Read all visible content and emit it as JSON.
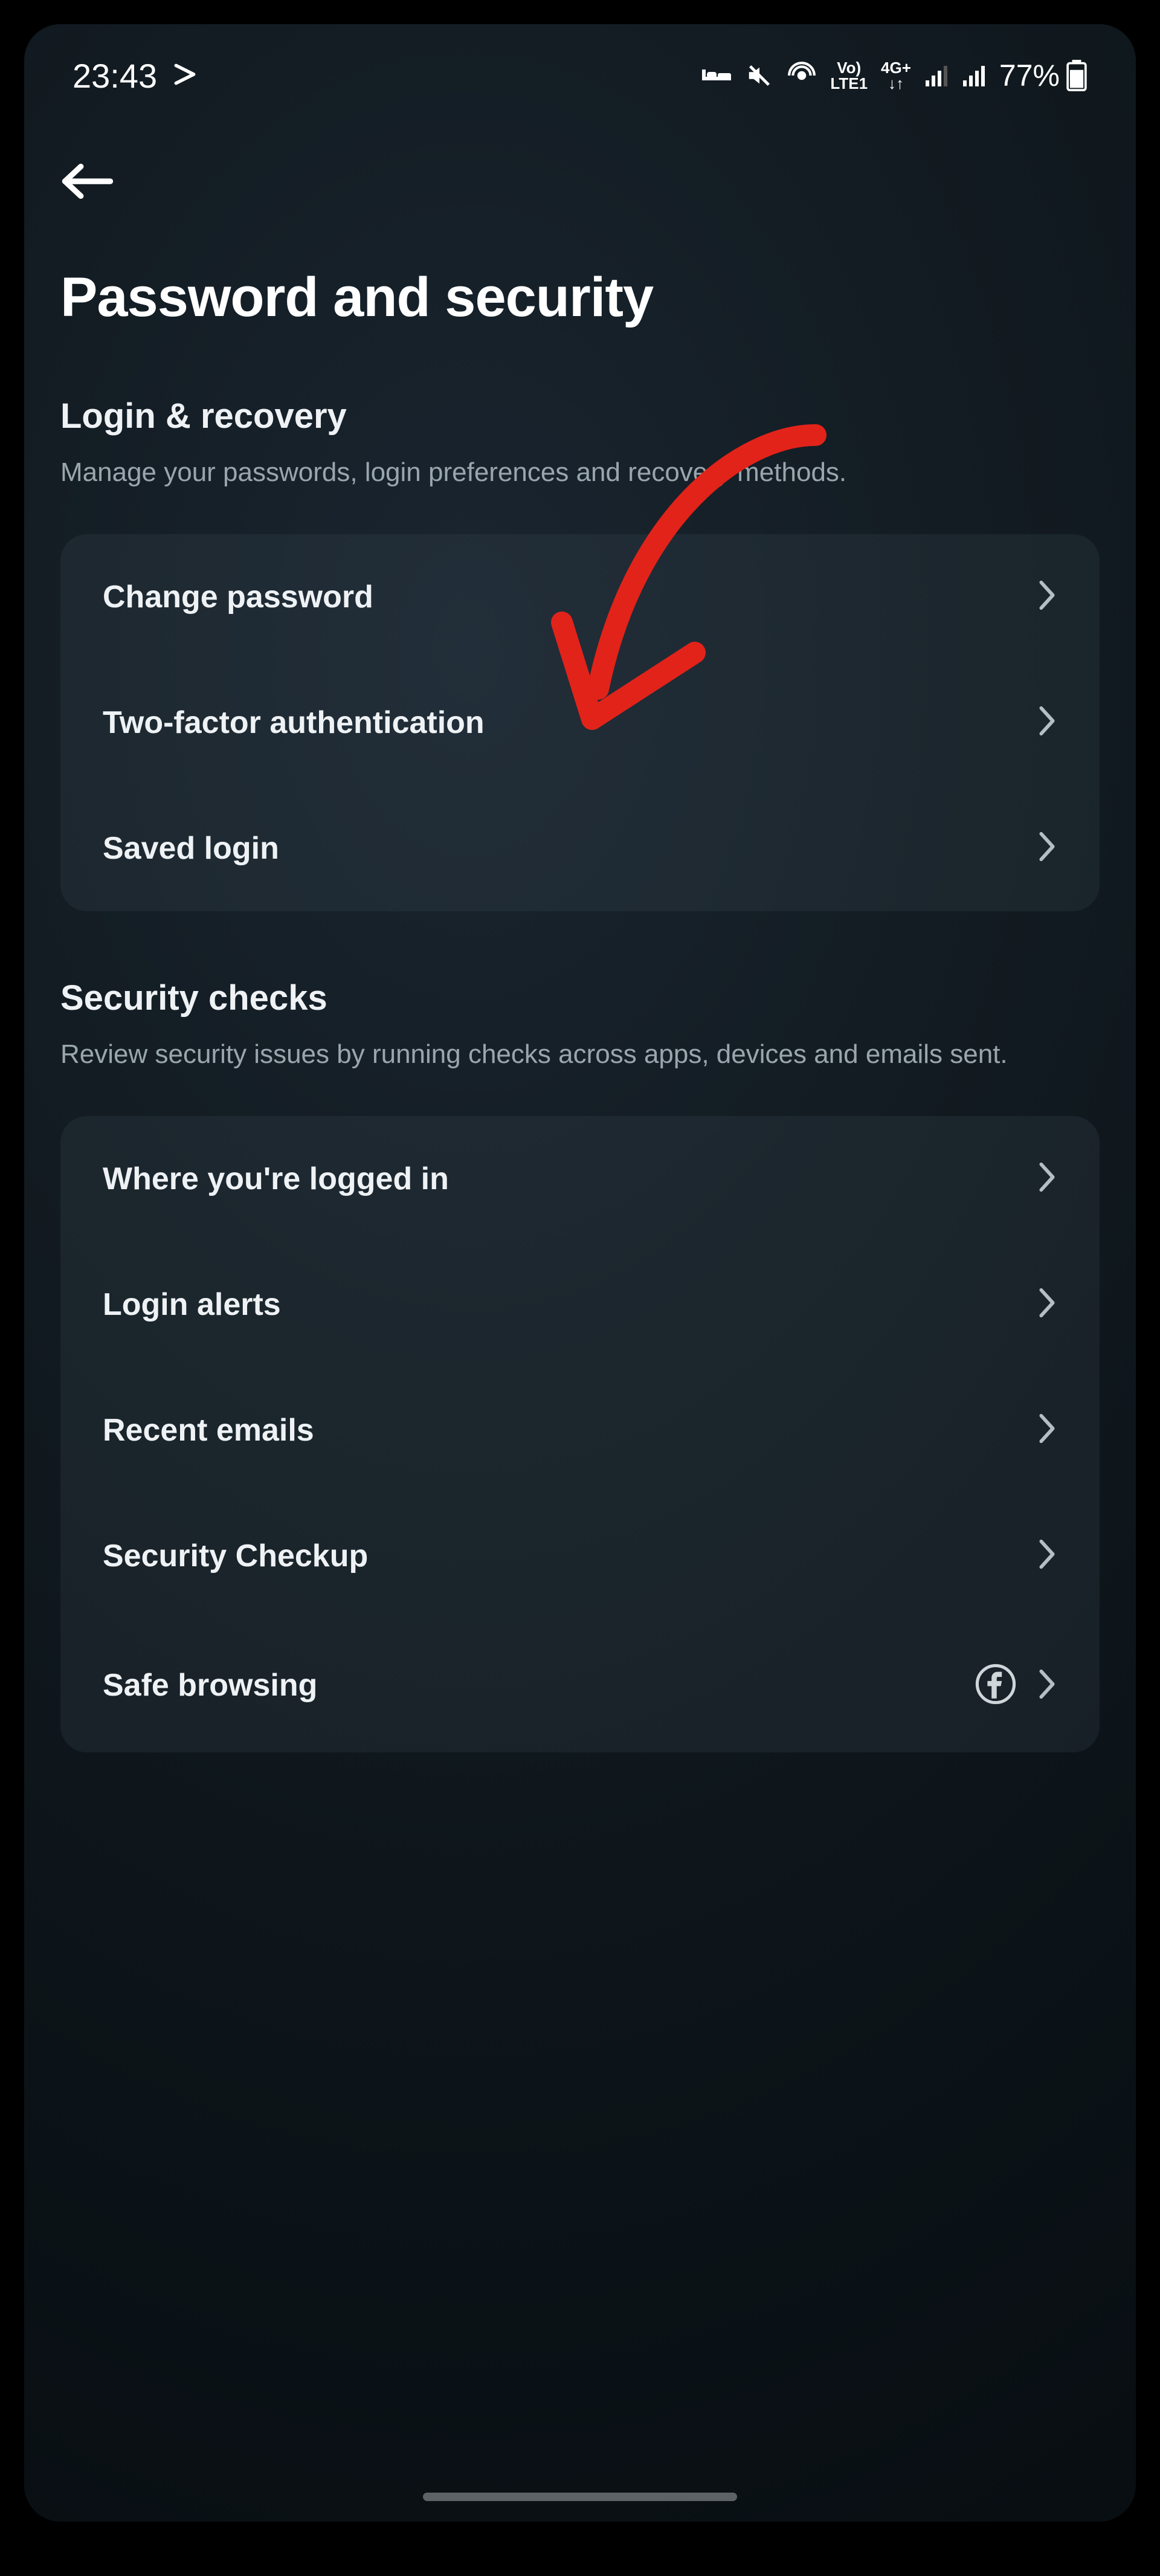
{
  "statusbar": {
    "time": "23:43",
    "battery_text": "77%"
  },
  "header": {
    "title": "Password and security"
  },
  "sections": {
    "login_recovery": {
      "title": "Login & recovery",
      "desc": "Manage your passwords, login preferences and recovery methods.",
      "items": [
        {
          "label": "Change password"
        },
        {
          "label": "Two-factor authentication"
        },
        {
          "label": "Saved login"
        }
      ]
    },
    "security_checks": {
      "title": "Security checks",
      "desc": "Review security issues by running checks across apps, devices and emails sent.",
      "items": [
        {
          "label": "Where you're logged in"
        },
        {
          "label": "Login alerts"
        },
        {
          "label": "Recent emails"
        },
        {
          "label": "Security Checkup"
        },
        {
          "label": "Safe browsing",
          "right_icon": "facebook-icon"
        }
      ]
    }
  },
  "annotation": {
    "type": "red-arrow",
    "target": "two-factor-authentication"
  }
}
